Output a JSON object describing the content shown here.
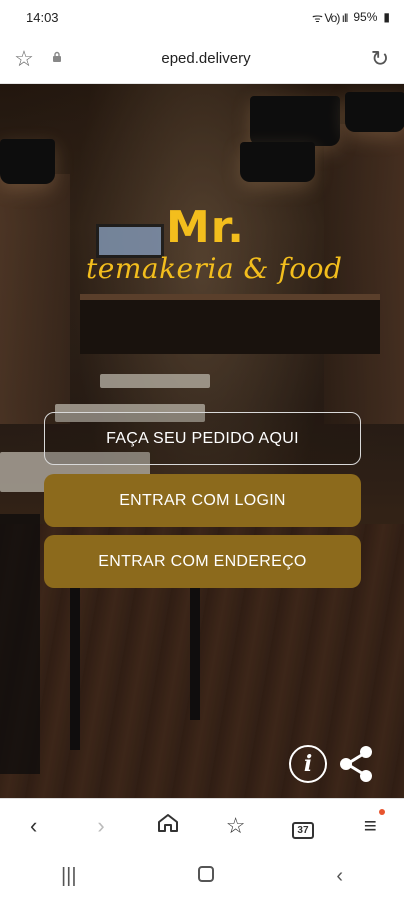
{
  "status_bar": {
    "time": "14:03",
    "signal": "ᯤ Vo) ıll",
    "battery_text": "95%"
  },
  "browser": {
    "url": "eped.delivery",
    "tabs_count": "37"
  },
  "brand": {
    "name": "Mr.",
    "tagline": "temakeria & food",
    "accent_color": "#f3be1d",
    "button_color": "#8c6a1c"
  },
  "actions": {
    "order_label": "FAÇA SEU PEDIDO AQUI",
    "login_label": "ENTRAR COM LOGIN",
    "address_label": "ENTRAR COM ENDEREÇO"
  },
  "icons": {
    "info": "i",
    "star": "☆",
    "lock": "🔒",
    "reload": "↻",
    "back": "‹",
    "forward": "›",
    "home": "⌂",
    "bookmarks": "☆",
    "menu": "≡",
    "recents": "|||",
    "sys_back": "‹"
  }
}
